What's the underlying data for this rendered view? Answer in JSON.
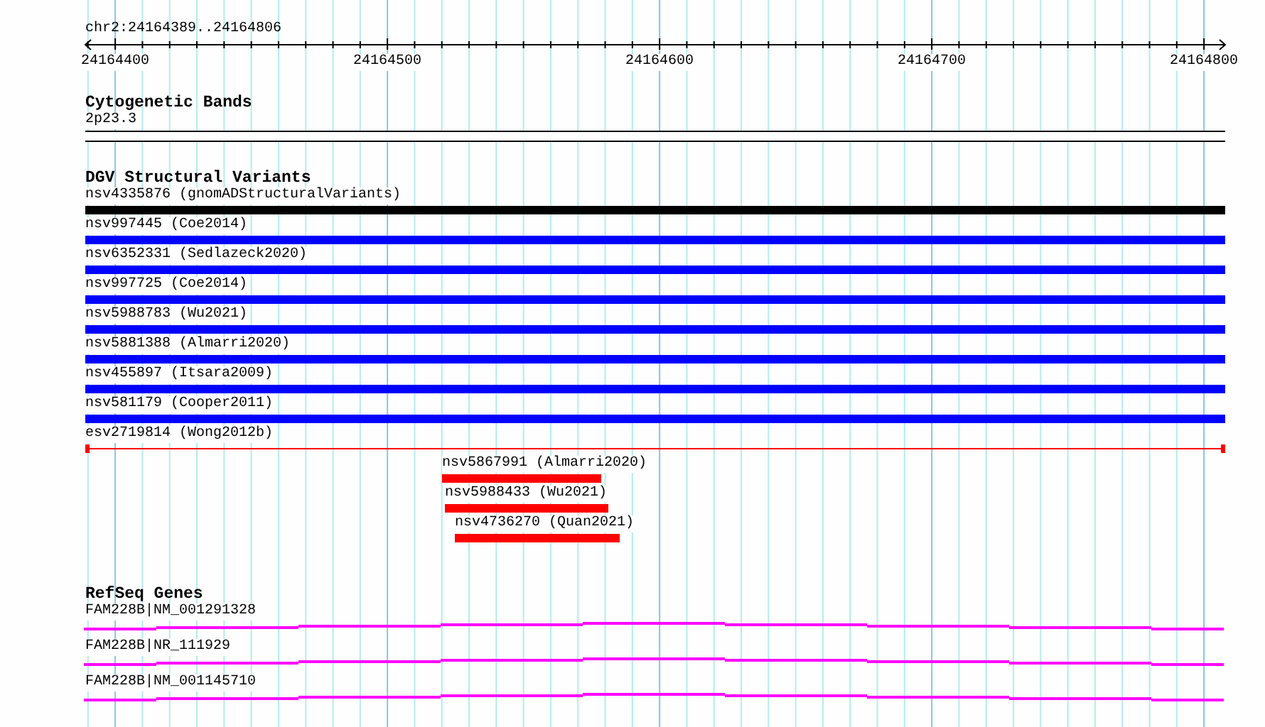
{
  "ruler": {
    "location": "chr2:24164389..24164806",
    "ticks": [
      "24164400",
      "24164500",
      "24164600",
      "24164700",
      "24164800"
    ]
  },
  "tracks": [
    {
      "kind": "bands",
      "title": "Cytogenetic Bands",
      "features": [
        {
          "label": "2p23.3"
        }
      ]
    },
    {
      "kind": "variants",
      "title": "DGV Structural Variants",
      "features": [
        {
          "label": "nsv4335876 (gnomADStructuralVariants)",
          "kind": "bar",
          "color": "#000000"
        },
        {
          "label": "nsv997445 (Coe2014)",
          "kind": "bar",
          "color": "#0000ff"
        },
        {
          "label": "nsv6352331 (Sedlazeck2020)",
          "kind": "bar",
          "color": "#0000ff"
        },
        {
          "label": "nsv997725 (Coe2014)",
          "kind": "bar",
          "color": "#0000ff"
        },
        {
          "label": "nsv5988783 (Wu2021)",
          "kind": "bar",
          "color": "#0000ff"
        },
        {
          "label": "nsv5881388 (Almarri2020)",
          "kind": "bar",
          "color": "#0000ff"
        },
        {
          "label": "nsv455897 (Itsara2009)",
          "kind": "bar",
          "color": "#0000ff"
        },
        {
          "label": "nsv581179 (Cooper2011)",
          "kind": "bar",
          "color": "#0000ff"
        },
        {
          "label": "esv2719814 (Wong2012b)",
          "kind": "line",
          "color": "#ff0000"
        },
        {
          "label": "nsv5867991 (Almarri2020)",
          "kind": "bar",
          "color": "#ff0000"
        },
        {
          "label": "nsv5988433 (Wu2021)",
          "kind": "bar",
          "color": "#ff0000"
        },
        {
          "label": "nsv4736270 (Quan2021)",
          "kind": "bar",
          "color": "#ff0000"
        }
      ]
    },
    {
      "kind": "genes",
      "title": "RefSeq Genes",
      "features": [
        {
          "label": "FAM228B|NM_001291328"
        },
        {
          "label": "FAM228B|NR_111929"
        },
        {
          "label": "FAM228B|NM_001145710"
        }
      ]
    }
  ]
}
